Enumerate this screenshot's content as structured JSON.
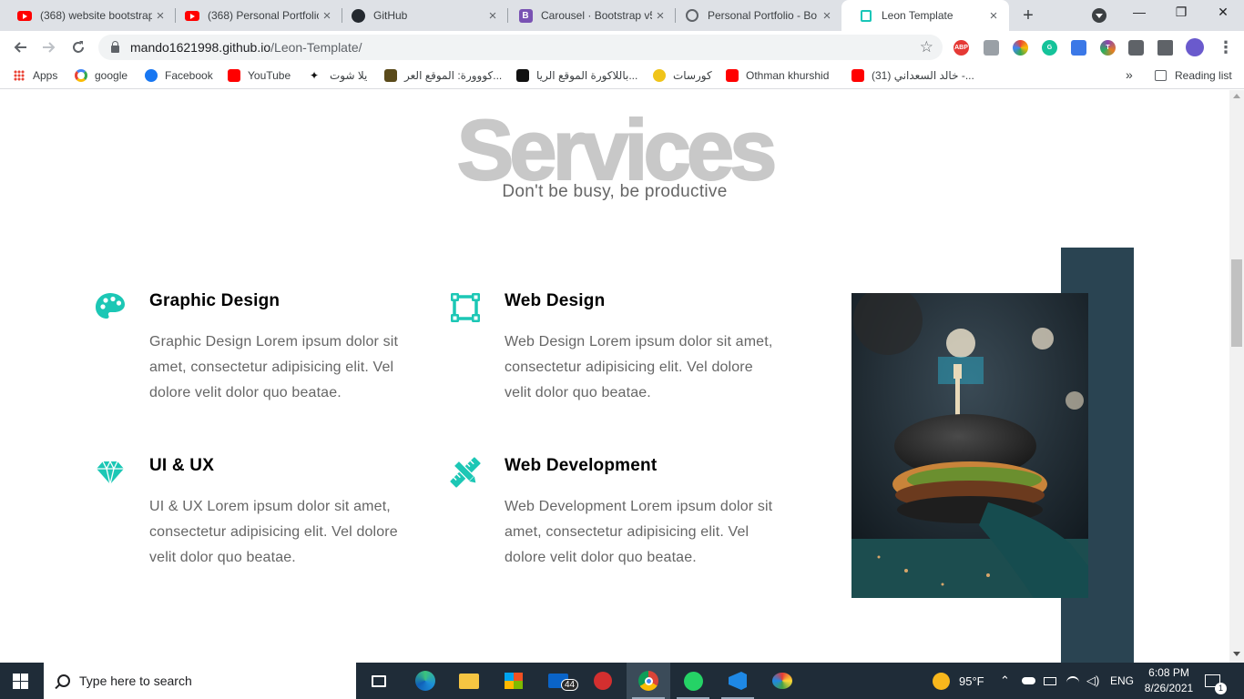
{
  "browser": {
    "tabs": [
      {
        "title": "(368) website bootstrap",
        "icon": "youtube-icon"
      },
      {
        "title": "(368) Personal Portfolio",
        "icon": "youtube-icon"
      },
      {
        "title": "GitHub",
        "icon": "github-icon"
      },
      {
        "title": "Carousel · Bootstrap v5",
        "icon": "bootstrap-icon"
      },
      {
        "title": "Personal Portfolio - Bo",
        "icon": "globe-icon"
      },
      {
        "title": "Leon Template",
        "icon": "leon-icon"
      }
    ],
    "close_glyph": "×",
    "new_tab_glyph": "+",
    "window_controls": {
      "minimize": "—",
      "restore": "❐",
      "close": "✕"
    },
    "url": {
      "host": "mando1621998.github.io",
      "path": "/Leon-Template/"
    },
    "bookmarks": [
      {
        "label": "Apps",
        "icon": "apps-grid-icon"
      },
      {
        "label": "google",
        "icon": "google-icon"
      },
      {
        "label": "Facebook",
        "icon": "facebook-icon"
      },
      {
        "label": "YouTube",
        "icon": "youtube-icon"
      },
      {
        "label": "يلا شوت",
        "icon": "yalla-shoot-icon"
      },
      {
        "label": "كووورة: الموقع العر...",
        "icon": "kooora-icon"
      },
      {
        "label": "باللاكورة الموقع الريا...",
        "icon": "yallakora-icon"
      },
      {
        "label": "كورسات",
        "icon": "courses-icon"
      },
      {
        "label": "Othman khurshid",
        "icon": "youtube-icon"
      },
      {
        "label": "(31) خالد السعداني -...",
        "icon": "youtube-icon"
      }
    ],
    "bookmarks_overflow": "»",
    "reading_list": "Reading list"
  },
  "page": {
    "section_title": "Services",
    "section_subtitle": "Don't be busy, be productive",
    "services": [
      {
        "title": "Graphic Design",
        "icon": "palette-icon",
        "text": "Graphic Design Lorem ipsum dolor sit amet, consectetur adipisicing elit. Vel dolore velit dolor quo beatae."
      },
      {
        "title": "Web Design",
        "icon": "vector-square-icon",
        "text": "Web Design Lorem ipsum dolor sit amet, consectetur adipisicing elit. Vel dolore velit dolor quo beatae."
      },
      {
        "title": "UI & UX",
        "icon": "gem-icon",
        "text": "UI & UX Lorem ipsum dolor sit amet, consectetur adipisicing elit. Vel dolore velit dolor quo beatae."
      },
      {
        "title": "Web Development",
        "icon": "pencil-ruler-icon",
        "text": "Web Development Lorem ipsum dolor sit amet, consectetur adipisicing elit. Vel dolore velit dolor quo beatae."
      }
    ],
    "accent_color": "#1cc7b5",
    "block_color": "#2a4452"
  },
  "taskbar": {
    "search_placeholder": "Type here to search",
    "mail_badge": "44",
    "weather": "95°F",
    "language": "ENG",
    "time": "6:08 PM",
    "date": "8/26/2021",
    "notification_count": "1"
  }
}
